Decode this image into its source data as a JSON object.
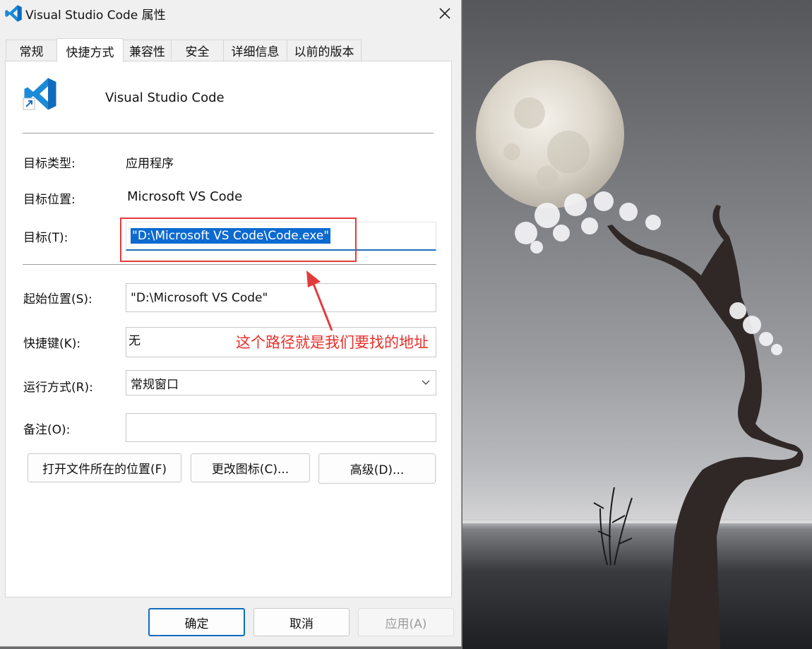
{
  "window": {
    "title": "Visual Studio Code 属性",
    "close_icon": "close-icon"
  },
  "tabs": [
    {
      "label": "常规",
      "active": false
    },
    {
      "label": "快捷方式",
      "active": true
    },
    {
      "label": "兼容性",
      "active": false
    },
    {
      "label": "安全",
      "active": false
    },
    {
      "label": "详细信息",
      "active": false
    },
    {
      "label": "以前的版本",
      "active": false
    }
  ],
  "shortcut": {
    "app_name": "Visual Studio Code",
    "app_icon": "vscode-icon",
    "target_type_label": "目标类型:",
    "target_type_value": "应用程序",
    "target_location_label": "目标位置:",
    "target_location_value": "Microsoft VS Code",
    "target_label": "目标(T):",
    "target_value": "\"D:\\Microsoft VS Code\\Code.exe\"",
    "start_in_label": "起始位置(S):",
    "start_in_value": "\"D:\\Microsoft VS Code\"",
    "hotkey_label": "快捷键(K):",
    "hotkey_value": "无",
    "run_label": "运行方式(R):",
    "run_value": "常规窗口",
    "comment_label": "备注(O):",
    "comment_value": ""
  },
  "buttons": {
    "open_location": "打开文件所在的位置(F)",
    "change_icon": "更改图标(C)...",
    "advanced": "高级(D)...",
    "ok": "确定",
    "cancel": "取消",
    "apply": "应用(A)"
  },
  "annotation": {
    "text": "这个路径就是我们要找的地址",
    "color": "#e8302a"
  },
  "colors": {
    "accent": "#0f6cbd",
    "selection": "#0c6ad1"
  }
}
